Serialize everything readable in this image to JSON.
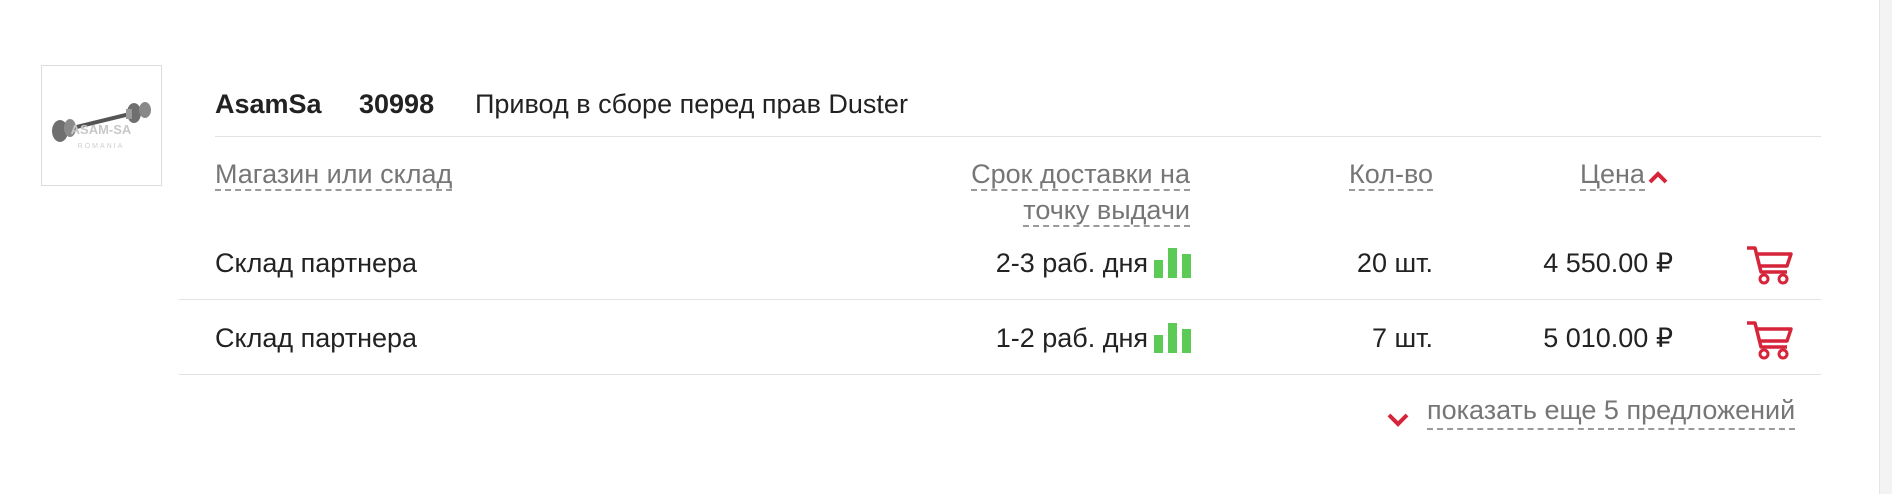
{
  "product": {
    "brand": "AsamSa",
    "article": "30998",
    "title": "Привод в сборе перед прав Duster",
    "thumbnail_logo": "ASAM-SA",
    "thumbnail_sub": "ROMANIA"
  },
  "columns": {
    "store": "Магазин или склад",
    "delivery_line1": "Срок доставки на",
    "delivery_line2": "точку выдачи",
    "qty": "Кол-во",
    "price": "Цена"
  },
  "offers": [
    {
      "store": "Склад партнера",
      "delivery": "2-3 раб. дня",
      "qty": "20 шт.",
      "price": "4 550.00 ₽",
      "reliability": 3
    },
    {
      "store": "Склад партнера",
      "delivery": "1-2 раб. дня",
      "qty": "7 шт.",
      "price": "5 010.00 ₽",
      "reliability": 3
    }
  ],
  "show_more": "показать еще 5 предложений",
  "icons": {
    "sort": "chevron-up-icon",
    "cart": "cart-icon",
    "more": "chevron-down-icon",
    "reliability": "signal-bars-icon"
  },
  "colors": {
    "accent_red": "#d6243a",
    "bars_green": "#5ccb55",
    "header_gray": "#767676"
  }
}
